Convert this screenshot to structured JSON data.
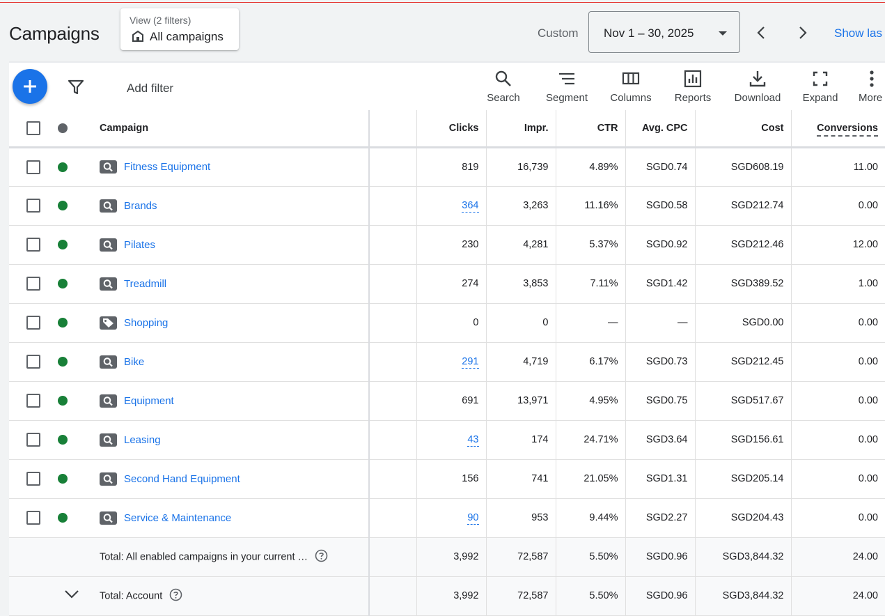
{
  "header": {
    "title": "Campaigns",
    "view_sub": "View (2 filters)",
    "view_main": "All campaigns",
    "custom_label": "Custom",
    "date_range": "Nov 1 – 30, 2025",
    "show_last": "Show las"
  },
  "toolbar": {
    "add_filter": "Add filter",
    "search": "Search",
    "segment": "Segment",
    "columns": "Columns",
    "reports": "Reports",
    "download": "Download",
    "expand": "Expand",
    "more": "More"
  },
  "table": {
    "headers": {
      "campaign": "Campaign",
      "clicks": "Clicks",
      "impr": "Impr.",
      "ctr": "CTR",
      "avg_cpc": "Avg. CPC",
      "cost": "Cost",
      "conversions": "Conversions"
    },
    "rows": [
      {
        "name": "Fitness Equipment",
        "type": "search",
        "clicks": "819",
        "clicks_link": false,
        "impr": "16,739",
        "ctr": "4.89%",
        "cpc": "SGD0.74",
        "cost": "SGD608.19",
        "conv": "11.00"
      },
      {
        "name": "Brands",
        "type": "search",
        "clicks": "364",
        "clicks_link": true,
        "impr": "3,263",
        "ctr": "11.16%",
        "cpc": "SGD0.58",
        "cost": "SGD212.74",
        "conv": "0.00"
      },
      {
        "name": "Pilates",
        "type": "search",
        "clicks": "230",
        "clicks_link": false,
        "impr": "4,281",
        "ctr": "5.37%",
        "cpc": "SGD0.92",
        "cost": "SGD212.46",
        "conv": "12.00"
      },
      {
        "name": "Treadmill",
        "type": "search",
        "clicks": "274",
        "clicks_link": false,
        "impr": "3,853",
        "ctr": "7.11%",
        "cpc": "SGD1.42",
        "cost": "SGD389.52",
        "conv": "1.00"
      },
      {
        "name": "Shopping",
        "type": "shopping",
        "clicks": "0",
        "clicks_link": false,
        "impr": "0",
        "ctr": "—",
        "cpc": "—",
        "cost": "SGD0.00",
        "conv": "0.00"
      },
      {
        "name": "Bike",
        "type": "search",
        "clicks": "291",
        "clicks_link": true,
        "impr": "4,719",
        "ctr": "6.17%",
        "cpc": "SGD0.73",
        "cost": "SGD212.45",
        "conv": "0.00"
      },
      {
        "name": "Equipment",
        "type": "search",
        "clicks": "691",
        "clicks_link": false,
        "impr": "13,971",
        "ctr": "4.95%",
        "cpc": "SGD0.75",
        "cost": "SGD517.67",
        "conv": "0.00"
      },
      {
        "name": "Leasing",
        "type": "search",
        "clicks": "43",
        "clicks_link": true,
        "impr": "174",
        "ctr": "24.71%",
        "cpc": "SGD3.64",
        "cost": "SGD156.61",
        "conv": "0.00"
      },
      {
        "name": "Second Hand Equipment",
        "type": "search",
        "clicks": "156",
        "clicks_link": false,
        "impr": "741",
        "ctr": "21.05%",
        "cpc": "SGD1.31",
        "cost": "SGD205.14",
        "conv": "0.00"
      },
      {
        "name": "Service & Maintenance",
        "type": "search",
        "clicks": "90",
        "clicks_link": true,
        "impr": "953",
        "ctr": "9.44%",
        "cpc": "SGD2.27",
        "cost": "SGD204.43",
        "conv": "0.00"
      }
    ],
    "totals": [
      {
        "label": "Total: All enabled campaigns in your current …",
        "clicks": "3,992",
        "impr": "72,587",
        "ctr": "5.50%",
        "cpc": "SGD0.96",
        "cost": "SGD3,844.32",
        "conv": "24.00"
      },
      {
        "label": "Total: Account",
        "clicks": "3,992",
        "impr": "72,587",
        "ctr": "5.50%",
        "cpc": "SGD0.96",
        "cost": "SGD3,844.32",
        "conv": "24.00"
      }
    ]
  },
  "colors": {
    "accent": "#1a73e8",
    "enabled": "#188038",
    "background": "#f1f3f4"
  }
}
